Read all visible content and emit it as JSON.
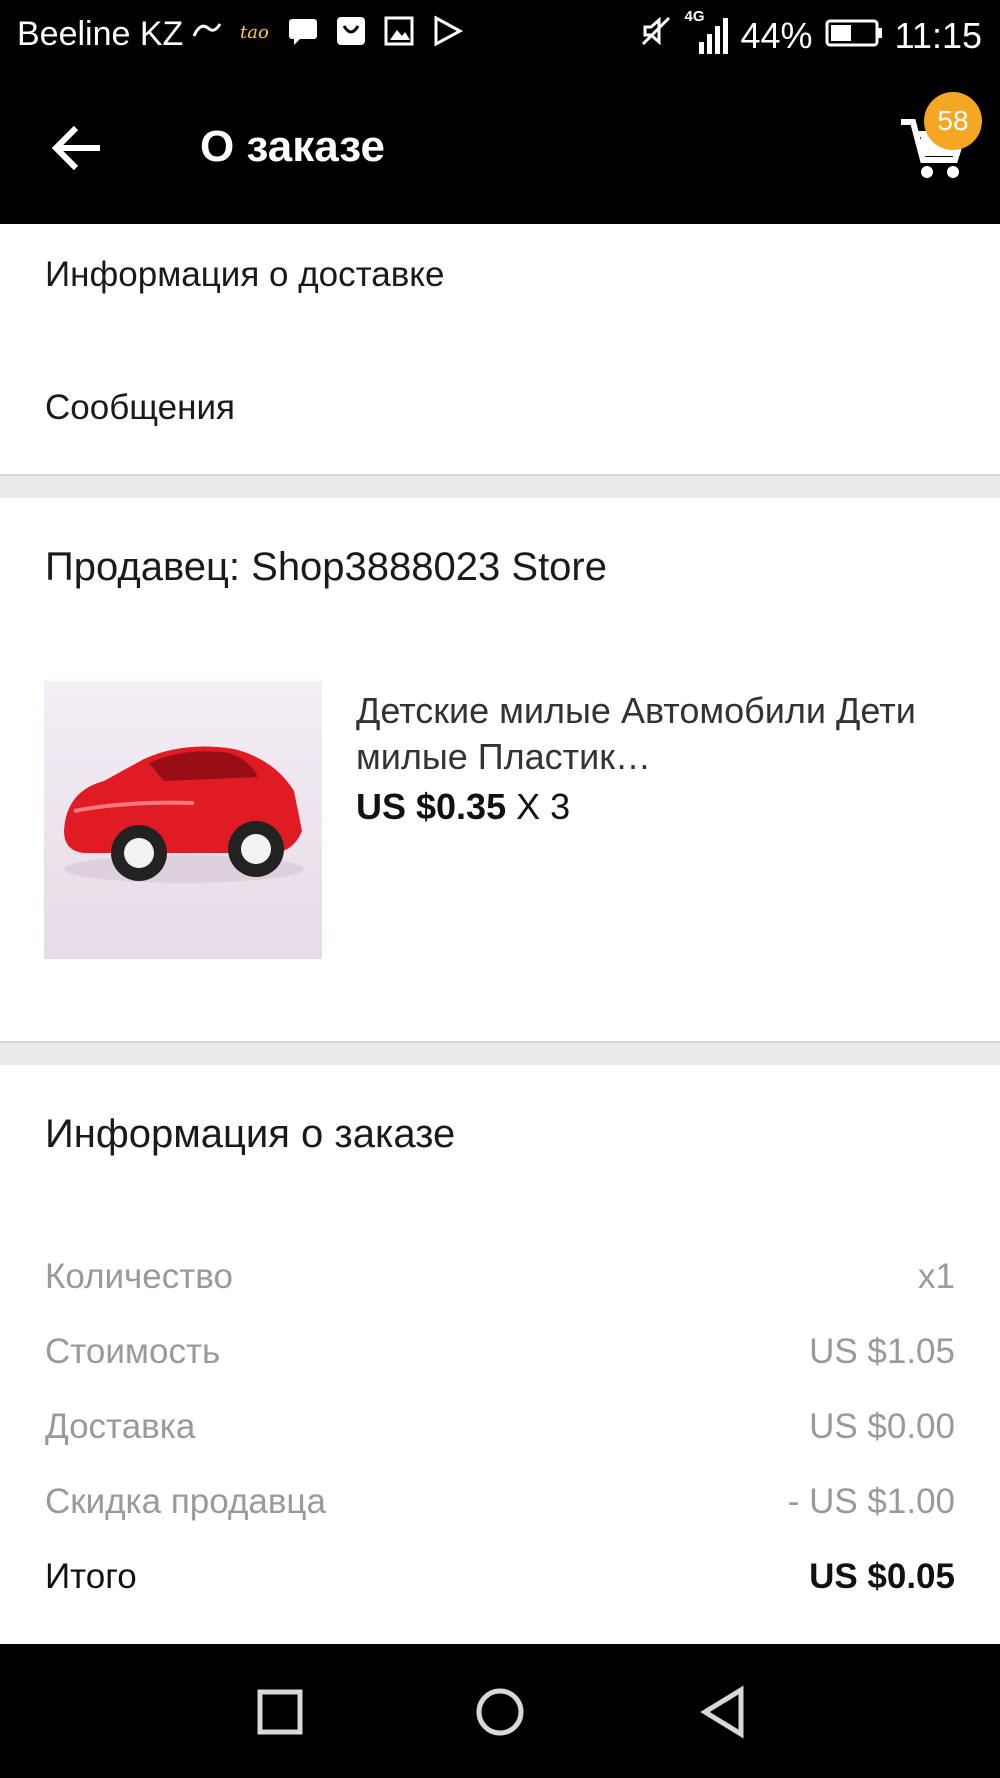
{
  "status_bar": {
    "carrier": "Beeline KZ",
    "network": "4G",
    "battery": "44%",
    "time": "11:15"
  },
  "app_bar": {
    "title": "О заказе",
    "cart_count": "58"
  },
  "links": {
    "delivery_info": "Информация о доставке",
    "messages": "Сообщения"
  },
  "seller": {
    "label": "Продавец: Shop3888023 Store"
  },
  "product": {
    "title": "Детские милые Автомобили Дети милые Пластик…",
    "price": "US $0.35",
    "qty": "X 3"
  },
  "order_info": {
    "title": "Информация о заказе",
    "rows": [
      {
        "label": "Количество",
        "value": "x1"
      },
      {
        "label": "Стоимость",
        "value": "US $1.05"
      },
      {
        "label": "Доставка",
        "value": "US $0.00"
      },
      {
        "label": "Скидка продавца",
        "value": "- US $1.00"
      },
      {
        "label": "Итого",
        "value": "US $0.05"
      }
    ]
  },
  "colors": {
    "badge": "#f5a623",
    "bar": "#000000",
    "divider": "#eaeaea"
  }
}
